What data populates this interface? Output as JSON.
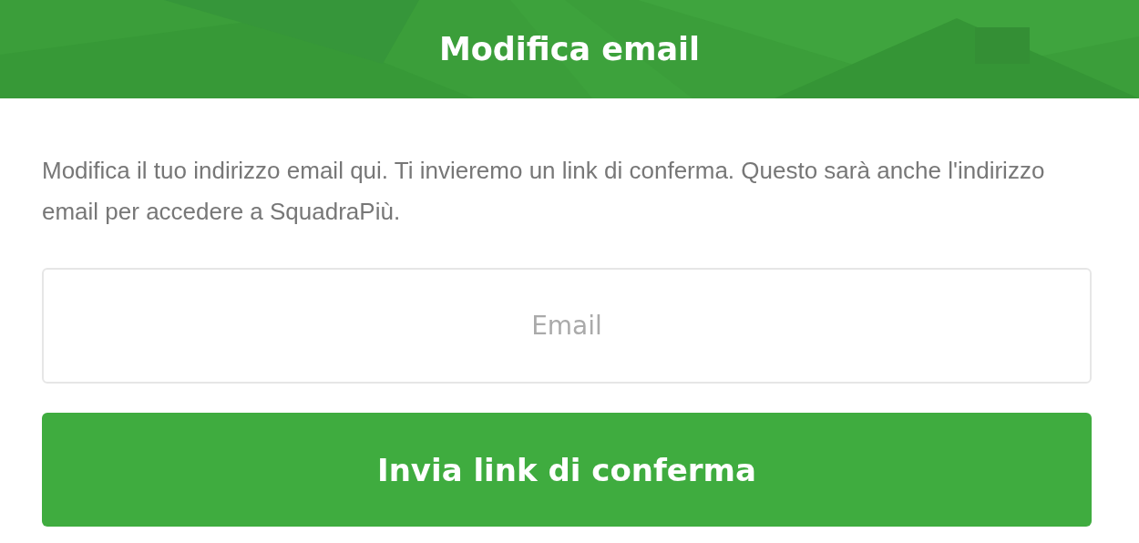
{
  "header": {
    "title": "Modifica email"
  },
  "description": "Modifica il tuo indirizzo email qui. Ti invieremo un link di conferma. Questo sarà anche l'indirizzo email per accedere a SquadraPiù.",
  "email_field": {
    "placeholder": "Email"
  },
  "submit_button": {
    "label": "Invia link di conferma"
  }
}
